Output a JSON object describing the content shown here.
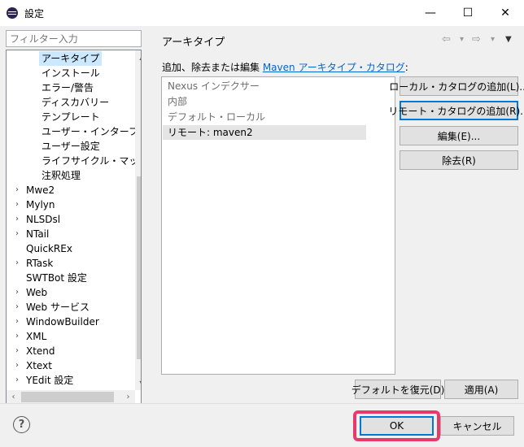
{
  "window": {
    "title": "設定",
    "minimize": "—",
    "maximize": "☐",
    "close": "✕"
  },
  "filter": {
    "placeholder": "フィルター入力"
  },
  "tree": {
    "items": [
      {
        "label": "アーキタイプ",
        "level": 2,
        "selected": true
      },
      {
        "label": "インストール",
        "level": 2
      },
      {
        "label": "エラー/警告",
        "level": 2
      },
      {
        "label": "ディスカバリー",
        "level": 2
      },
      {
        "label": "テンプレート",
        "level": 2
      },
      {
        "label": "ユーザー・インターフェース",
        "level": 2
      },
      {
        "label": "ユーザー設定",
        "level": 2
      },
      {
        "label": "ライフサイクル・マッピング",
        "level": 2
      },
      {
        "label": "注釈処理",
        "level": 2
      },
      {
        "label": "Mwe2",
        "level": 1,
        "expandable": true
      },
      {
        "label": "Mylyn",
        "level": 1,
        "expandable": true
      },
      {
        "label": "NLSDsl",
        "level": 1,
        "expandable": true
      },
      {
        "label": "NTail",
        "level": 1,
        "expandable": true
      },
      {
        "label": "QuickREx",
        "level": 1,
        "expandable": false
      },
      {
        "label": "RTask",
        "level": 1,
        "expandable": true
      },
      {
        "label": "SWTBot 設定",
        "level": 1,
        "expandable": false
      },
      {
        "label": "Web",
        "level": 1,
        "expandable": true
      },
      {
        "label": "Web サービス",
        "level": 1,
        "expandable": true
      },
      {
        "label": "WindowBuilder",
        "level": 1,
        "expandable": true
      },
      {
        "label": "XML",
        "level": 1,
        "expandable": true
      },
      {
        "label": "Xtend",
        "level": 1,
        "expandable": true
      },
      {
        "label": "Xtext",
        "level": 1,
        "expandable": true
      },
      {
        "label": "YEdit 設定",
        "level": 1,
        "expandable": true
      }
    ]
  },
  "page": {
    "title": "アーキタイプ",
    "desc_prefix": "追加、除去または編集 ",
    "desc_link": "Maven アーキタイプ・カタログ",
    "desc_suffix": ":"
  },
  "nav": {
    "back": "⇦",
    "back_menu": "▾",
    "forward": "⇨",
    "forward_menu": "▾",
    "menu": "▼"
  },
  "catalogs": [
    {
      "label": "Nexus インデクサー",
      "enabled": false
    },
    {
      "label": "内部",
      "enabled": false
    },
    {
      "label": "デフォルト・ローカル",
      "enabled": false
    },
    {
      "label": "リモート: maven2",
      "enabled": true,
      "selected": true
    }
  ],
  "buttons": {
    "add_local": "ローカル・カタログの追加(L)...",
    "add_remote": "リモート・カタログの追加(R)...",
    "edit": "編集(E)...",
    "remove": "除去(R)",
    "restore_defaults": "デフォルトを復元(D)",
    "apply": "適用(A)",
    "ok": "OK",
    "cancel": "キャンセル"
  },
  "help": {
    "icon": "?"
  },
  "colors": {
    "link": "#0066cc",
    "selection": "#cce8ff",
    "focus": "#0078d7",
    "highlight": "#e8396b"
  }
}
